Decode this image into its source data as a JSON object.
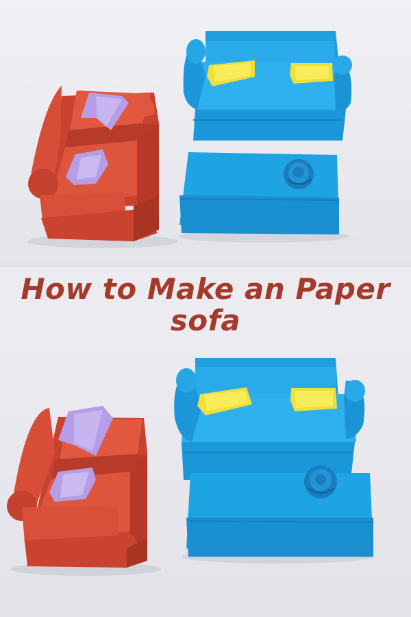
{
  "title": {
    "line1": "How to Make an Paper",
    "line2": "sofa"
  },
  "colors": {
    "background": "#e9e9ee",
    "title_text": "#a33a2a",
    "red_paper": "#d8513d",
    "blue_paper": "#1ea3e3",
    "yellow_paper": "#f4e445",
    "lilac_paper": "#b7a2e8"
  }
}
